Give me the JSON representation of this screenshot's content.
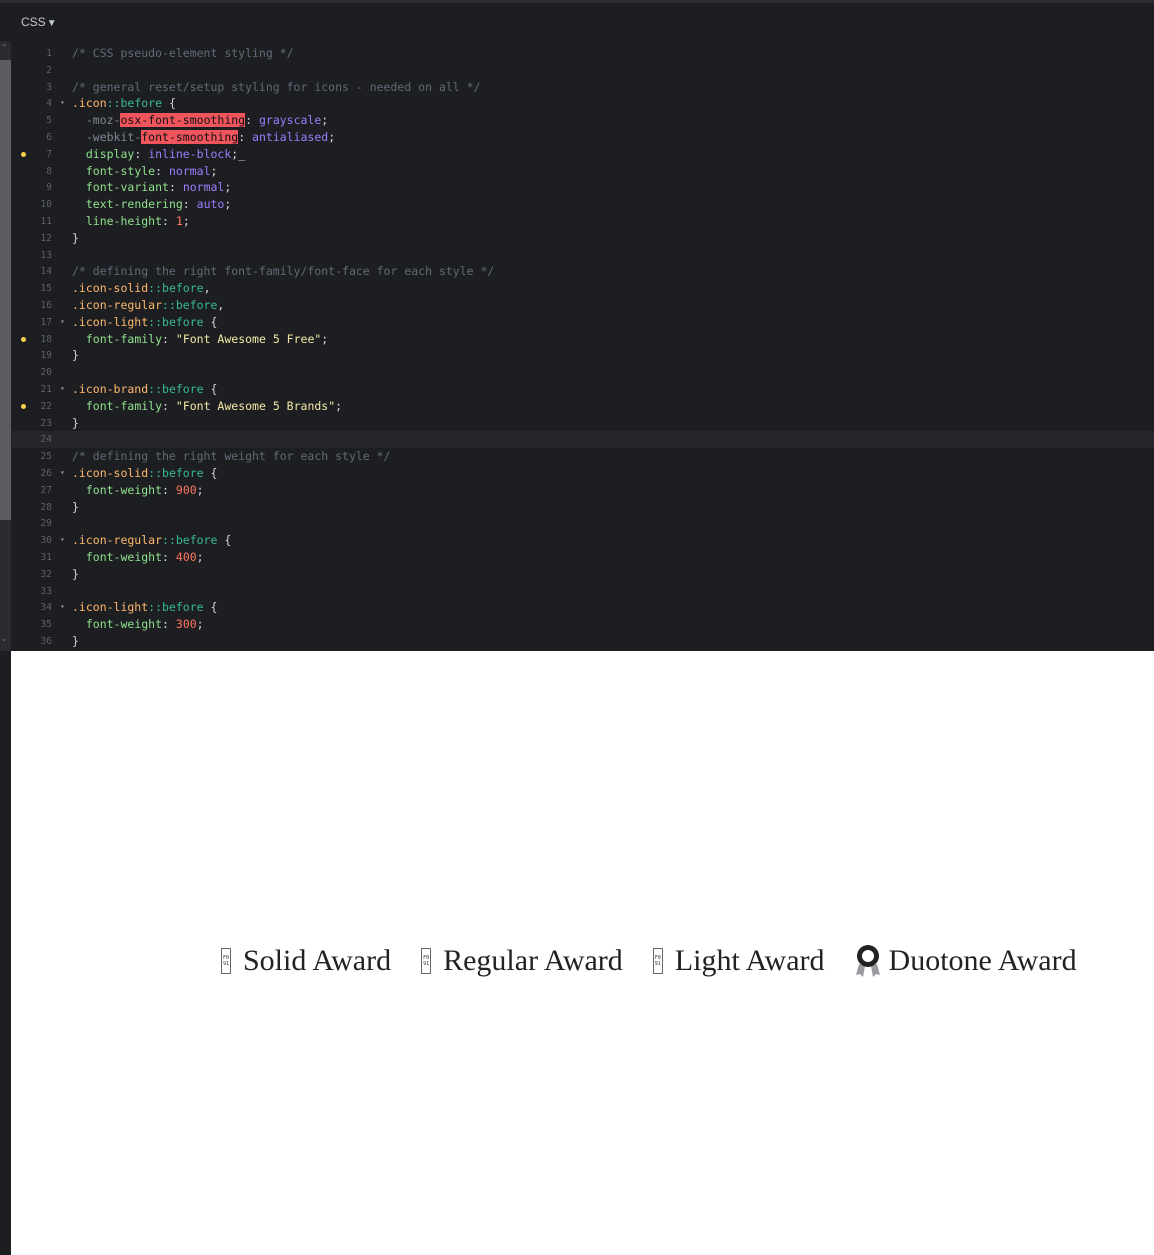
{
  "editor": {
    "language": "CSS",
    "lines": [
      {
        "n": "1",
        "fold": "",
        "dot": false,
        "active": false,
        "tokens": [
          [
            "c-com",
            "/* CSS pseudo-element styling */"
          ]
        ]
      },
      {
        "n": "2",
        "fold": "",
        "dot": false,
        "active": false,
        "tokens": []
      },
      {
        "n": "3",
        "fold": "",
        "dot": false,
        "active": false,
        "tokens": [
          [
            "c-com",
            "/* general reset/setup styling for icons - needed on all */"
          ]
        ]
      },
      {
        "n": "4",
        "fold": "▾",
        "dot": false,
        "active": false,
        "tokens": [
          [
            "c-sel",
            ".icon"
          ],
          [
            "c-pse",
            "::before"
          ],
          [
            "c-punc",
            " {"
          ]
        ]
      },
      {
        "n": "5",
        "fold": "",
        "dot": false,
        "active": false,
        "tokens": [
          [
            "c-punc",
            "  "
          ],
          [
            "c-vend",
            "-moz-"
          ],
          [
            "c-hl",
            "osx-font-smoothing"
          ],
          [
            "c-punc",
            ": "
          ],
          [
            "c-val",
            "grayscale"
          ],
          [
            "c-punc",
            ";"
          ]
        ]
      },
      {
        "n": "6",
        "fold": "",
        "dot": false,
        "active": false,
        "tokens": [
          [
            "c-punc",
            "  "
          ],
          [
            "c-vend",
            "-webkit-"
          ],
          [
            "c-hl",
            "font-smoothing"
          ],
          [
            "c-punc",
            ": "
          ],
          [
            "c-val",
            "antialiased"
          ],
          [
            "c-punc",
            ";"
          ]
        ]
      },
      {
        "n": "7",
        "fold": "",
        "dot": true,
        "active": false,
        "tokens": [
          [
            "c-punc",
            "  "
          ],
          [
            "c-prop",
            "display"
          ],
          [
            "c-punc",
            ": "
          ],
          [
            "c-val",
            "inline-block"
          ],
          [
            "c-punc",
            ";_"
          ]
        ]
      },
      {
        "n": "8",
        "fold": "",
        "dot": false,
        "active": false,
        "tokens": [
          [
            "c-punc",
            "  "
          ],
          [
            "c-prop",
            "font-style"
          ],
          [
            "c-punc",
            ": "
          ],
          [
            "c-val",
            "normal"
          ],
          [
            "c-punc",
            ";"
          ]
        ]
      },
      {
        "n": "9",
        "fold": "",
        "dot": false,
        "active": false,
        "tokens": [
          [
            "c-punc",
            "  "
          ],
          [
            "c-prop",
            "font-variant"
          ],
          [
            "c-punc",
            ": "
          ],
          [
            "c-val",
            "normal"
          ],
          [
            "c-punc",
            ";"
          ]
        ]
      },
      {
        "n": "10",
        "fold": "",
        "dot": false,
        "active": false,
        "tokens": [
          [
            "c-punc",
            "  "
          ],
          [
            "c-prop",
            "text-rendering"
          ],
          [
            "c-punc",
            ": "
          ],
          [
            "c-val",
            "auto"
          ],
          [
            "c-punc",
            ";"
          ]
        ]
      },
      {
        "n": "11",
        "fold": "",
        "dot": false,
        "active": false,
        "tokens": [
          [
            "c-punc",
            "  "
          ],
          [
            "c-prop",
            "line-height"
          ],
          [
            "c-punc",
            ": "
          ],
          [
            "c-num",
            "1"
          ],
          [
            "c-punc",
            ";"
          ]
        ]
      },
      {
        "n": "12",
        "fold": "",
        "dot": false,
        "active": false,
        "tokens": [
          [
            "c-punc",
            "}"
          ]
        ]
      },
      {
        "n": "13",
        "fold": "",
        "dot": false,
        "active": false,
        "tokens": []
      },
      {
        "n": "14",
        "fold": "",
        "dot": false,
        "active": false,
        "tokens": [
          [
            "c-com",
            "/* defining the right font-family/font-face for each style */"
          ]
        ]
      },
      {
        "n": "15",
        "fold": "",
        "dot": false,
        "active": false,
        "tokens": [
          [
            "c-sel",
            ".icon-solid"
          ],
          [
            "c-pse",
            "::before"
          ],
          [
            "c-punc",
            ","
          ]
        ]
      },
      {
        "n": "16",
        "fold": "",
        "dot": false,
        "active": false,
        "tokens": [
          [
            "c-sel",
            ".icon-regular"
          ],
          [
            "c-pse",
            "::before"
          ],
          [
            "c-punc",
            ","
          ]
        ]
      },
      {
        "n": "17",
        "fold": "▾",
        "dot": false,
        "active": false,
        "tokens": [
          [
            "c-sel",
            ".icon-light"
          ],
          [
            "c-pse",
            "::before"
          ],
          [
            "c-punc",
            " {"
          ]
        ]
      },
      {
        "n": "18",
        "fold": "",
        "dot": true,
        "active": false,
        "tokens": [
          [
            "c-punc",
            "  "
          ],
          [
            "c-prop",
            "font-family"
          ],
          [
            "c-punc",
            ": "
          ],
          [
            "c-str",
            "\"Font Awesome 5 Free\""
          ],
          [
            "c-punc",
            ";"
          ]
        ]
      },
      {
        "n": "19",
        "fold": "",
        "dot": false,
        "active": false,
        "tokens": [
          [
            "c-punc",
            "}"
          ]
        ]
      },
      {
        "n": "20",
        "fold": "",
        "dot": false,
        "active": false,
        "tokens": []
      },
      {
        "n": "21",
        "fold": "▾",
        "dot": false,
        "active": false,
        "tokens": [
          [
            "c-sel",
            ".icon-brand"
          ],
          [
            "c-pse",
            "::before"
          ],
          [
            "c-punc",
            " {"
          ]
        ]
      },
      {
        "n": "22",
        "fold": "",
        "dot": true,
        "active": false,
        "tokens": [
          [
            "c-punc",
            "  "
          ],
          [
            "c-prop",
            "font-family"
          ],
          [
            "c-punc",
            ": "
          ],
          [
            "c-str",
            "\"Font Awesome 5 Brands\""
          ],
          [
            "c-punc",
            ";"
          ]
        ]
      },
      {
        "n": "23",
        "fold": "",
        "dot": false,
        "active": false,
        "tokens": [
          [
            "c-punc",
            "}"
          ]
        ]
      },
      {
        "n": "24",
        "fold": "",
        "dot": false,
        "active": true,
        "tokens": []
      },
      {
        "n": "25",
        "fold": "",
        "dot": false,
        "active": false,
        "tokens": [
          [
            "c-com",
            "/* defining the right weight for each style */"
          ]
        ]
      },
      {
        "n": "26",
        "fold": "▾",
        "dot": false,
        "active": false,
        "tokens": [
          [
            "c-sel",
            ".icon-solid"
          ],
          [
            "c-pse",
            "::before"
          ],
          [
            "c-punc",
            " {"
          ]
        ]
      },
      {
        "n": "27",
        "fold": "",
        "dot": false,
        "active": false,
        "tokens": [
          [
            "c-punc",
            "  "
          ],
          [
            "c-prop",
            "font-weight"
          ],
          [
            "c-punc",
            ": "
          ],
          [
            "c-num",
            "900"
          ],
          [
            "c-punc",
            ";"
          ]
        ]
      },
      {
        "n": "28",
        "fold": "",
        "dot": false,
        "active": false,
        "tokens": [
          [
            "c-punc",
            "}"
          ]
        ]
      },
      {
        "n": "29",
        "fold": "",
        "dot": false,
        "active": false,
        "tokens": []
      },
      {
        "n": "30",
        "fold": "▾",
        "dot": false,
        "active": false,
        "tokens": [
          [
            "c-sel",
            ".icon-regular"
          ],
          [
            "c-pse",
            "::before"
          ],
          [
            "c-punc",
            " {"
          ]
        ]
      },
      {
        "n": "31",
        "fold": "",
        "dot": false,
        "active": false,
        "tokens": [
          [
            "c-punc",
            "  "
          ],
          [
            "c-prop",
            "font-weight"
          ],
          [
            "c-punc",
            ": "
          ],
          [
            "c-num",
            "400"
          ],
          [
            "c-punc",
            ";"
          ]
        ]
      },
      {
        "n": "32",
        "fold": "",
        "dot": false,
        "active": false,
        "tokens": [
          [
            "c-punc",
            "}"
          ]
        ]
      },
      {
        "n": "33",
        "fold": "",
        "dot": false,
        "active": false,
        "tokens": []
      },
      {
        "n": "34",
        "fold": "▾",
        "dot": false,
        "active": false,
        "tokens": [
          [
            "c-sel",
            ".icon-light"
          ],
          [
            "c-pse",
            "::before"
          ],
          [
            "c-punc",
            " {"
          ]
        ]
      },
      {
        "n": "35",
        "fold": "",
        "dot": false,
        "active": false,
        "tokens": [
          [
            "c-punc",
            "  "
          ],
          [
            "c-prop",
            "font-weight"
          ],
          [
            "c-punc",
            ": "
          ],
          [
            "c-num",
            "300"
          ],
          [
            "c-punc",
            ";"
          ]
        ]
      },
      {
        "n": "36",
        "fold": "",
        "dot": false,
        "active": false,
        "tokens": [
          [
            "c-punc",
            "}"
          ]
        ]
      }
    ]
  },
  "preview": {
    "awards": [
      {
        "label": "Solid Award",
        "icon": "missing-glyph-icon",
        "glyph": "F0 91"
      },
      {
        "label": "Regular Award",
        "icon": "missing-glyph-icon",
        "glyph": "F0 91"
      },
      {
        "label": "Light Award",
        "icon": "missing-glyph-icon",
        "glyph": "F0 91"
      },
      {
        "label": "Duotone Award",
        "icon": "award-icon",
        "glyph": ""
      }
    ]
  },
  "colors": {
    "editor_bg": "#1d1e22",
    "comment": "#626978",
    "selector": "#ffb86c",
    "pseudo": "#37b995",
    "property": "#8fe18c",
    "value": "#9d7cff",
    "number": "#ff7561",
    "string": "#f3e9a6",
    "error_highlight": "#f0545c",
    "modified_dot": "#f9d048"
  }
}
